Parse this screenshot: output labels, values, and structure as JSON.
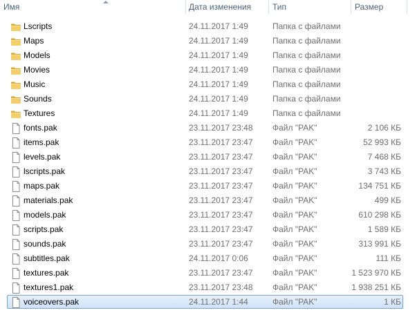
{
  "header": {
    "name": "Имя",
    "date": "Дата изменения",
    "type": "Тип",
    "size": "Размер"
  },
  "rows": [
    {
      "name": "Lscripts",
      "date": "24.11.2017 1:49",
      "type": "Папка с файлами",
      "size": "",
      "icon": "folder-icon"
    },
    {
      "name": "Maps",
      "date": "24.11.2017 1:49",
      "type": "Папка с файлами",
      "size": "",
      "icon": "folder-icon"
    },
    {
      "name": "Models",
      "date": "24.11.2017 1:49",
      "type": "Папка с файлами",
      "size": "",
      "icon": "folder-icon"
    },
    {
      "name": "Movies",
      "date": "24.11.2017 1:49",
      "type": "Папка с файлами",
      "size": "",
      "icon": "folder-icon"
    },
    {
      "name": "Music",
      "date": "24.11.2017 1:49",
      "type": "Папка с файлами",
      "size": "",
      "icon": "folder-icon"
    },
    {
      "name": "Sounds",
      "date": "24.11.2017 1:49",
      "type": "Папка с файлами",
      "size": "",
      "icon": "folder-icon"
    },
    {
      "name": "Textures",
      "date": "24.11.2017 1:49",
      "type": "Папка с файлами",
      "size": "",
      "icon": "folder-icon"
    },
    {
      "name": "fonts.pak",
      "date": "23.11.2017 23:48",
      "type": "Файл \"PAK\"",
      "size": "2 106 КБ",
      "icon": "file-icon"
    },
    {
      "name": "items.pak",
      "date": "23.11.2017 23:47",
      "type": "Файл \"PAK\"",
      "size": "52 993 КБ",
      "icon": "file-icon"
    },
    {
      "name": "levels.pak",
      "date": "23.11.2017 23:47",
      "type": "Файл \"PAK\"",
      "size": "7 468 КБ",
      "icon": "file-icon"
    },
    {
      "name": "lscripts.pak",
      "date": "23.11.2017 23:47",
      "type": "Файл \"PAK\"",
      "size": "3 743 КБ",
      "icon": "file-icon"
    },
    {
      "name": "maps.pak",
      "date": "23.11.2017 23:47",
      "type": "Файл \"PAK\"",
      "size": "134 751 КБ",
      "icon": "file-icon"
    },
    {
      "name": "materials.pak",
      "date": "23.11.2017 23:47",
      "type": "Файл \"PAK\"",
      "size": "499 КБ",
      "icon": "file-icon"
    },
    {
      "name": "models.pak",
      "date": "23.11.2017 23:47",
      "type": "Файл \"PAK\"",
      "size": "610 298 КБ",
      "icon": "file-icon"
    },
    {
      "name": "scripts.pak",
      "date": "23.11.2017 23:47",
      "type": "Файл \"PAK\"",
      "size": "1 589 КБ",
      "icon": "file-icon"
    },
    {
      "name": "sounds.pak",
      "date": "23.11.2017 23:47",
      "type": "Файл \"PAK\"",
      "size": "313 991 КБ",
      "icon": "file-icon"
    },
    {
      "name": "subtitles.pak",
      "date": "24.11.2017 0:06",
      "type": "Файл \"PAK\"",
      "size": "111 КБ",
      "icon": "file-icon"
    },
    {
      "name": "textures.pak",
      "date": "23.11.2017 23:47",
      "type": "Файл \"PAK\"",
      "size": "1 523 970 КБ",
      "icon": "file-icon"
    },
    {
      "name": "textures1.pak",
      "date": "23.11.2017 23:48",
      "type": "Файл \"PAK\"",
      "size": "1 938 251 КБ",
      "icon": "file-icon"
    },
    {
      "name": "voiceovers.pak",
      "date": "24.11.2017 1:44",
      "type": "Файл \"PAK\"",
      "size": "1 КБ",
      "icon": "file-icon",
      "selected": true
    }
  ],
  "colors": {
    "header_text": "#4c607a",
    "secondary_text": "#6d6d6d",
    "selection_border": "#7da2ce",
    "folder": "#e8c15a"
  }
}
